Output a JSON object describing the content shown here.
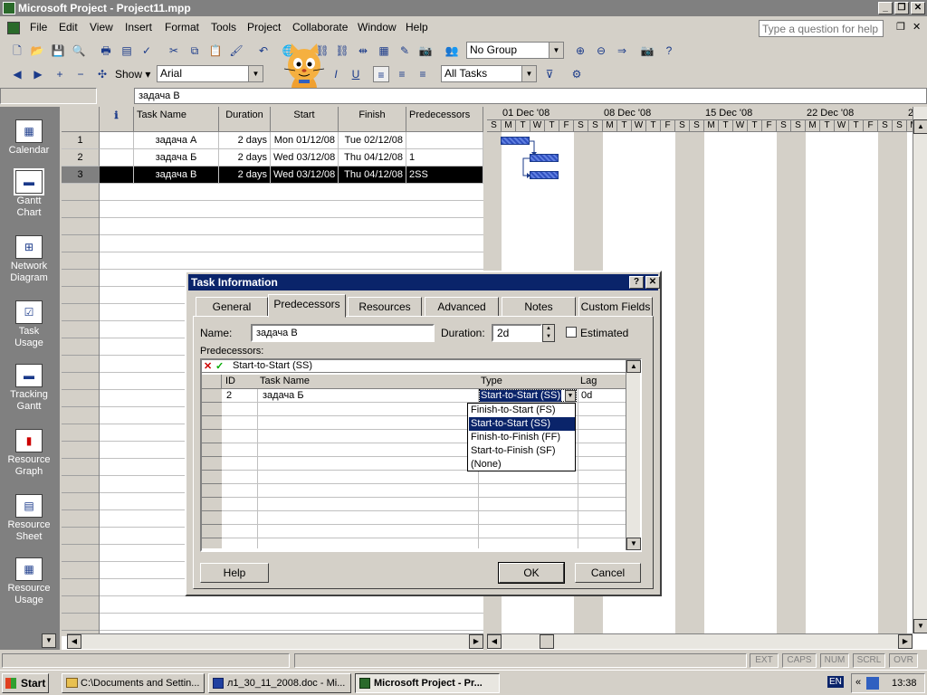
{
  "window": {
    "title": "Microsoft Project - Project11.mpp"
  },
  "menu": [
    "File",
    "Edit",
    "View",
    "Insert",
    "Format",
    "Tools",
    "Project",
    "Collaborate",
    "Window",
    "Help"
  ],
  "help_box": {
    "placeholder": "Type a question for help"
  },
  "toolbar1": {
    "group_value": "No Group"
  },
  "toolbar2": {
    "show_label": "Show",
    "font_value": "Arial",
    "filter_value": "All Tasks"
  },
  "entry_bar": {
    "value": "задача В"
  },
  "view_bar": [
    {
      "label": "Calendar",
      "icon": "calendar-icon"
    },
    {
      "label": "Gantt Chart",
      "icon": "gantt-chart-icon"
    },
    {
      "label": "Network Diagram",
      "icon": "network-diagram-icon"
    },
    {
      "label": "Task Usage",
      "icon": "task-usage-icon"
    },
    {
      "label": "Tracking Gantt",
      "icon": "tracking-gantt-icon"
    },
    {
      "label": "Resource Graph",
      "icon": "resource-graph-icon"
    },
    {
      "label": "Resource Sheet",
      "icon": "resource-sheet-icon"
    },
    {
      "label": "Resource Usage",
      "icon": "resource-usage-icon"
    }
  ],
  "table": {
    "headers": [
      "Task Name",
      "Duration",
      "Start",
      "Finish",
      "Predecessors"
    ],
    "rows": [
      {
        "id": "1",
        "name": "задача А",
        "duration": "2 days",
        "start": "Mon 01/12/08",
        "finish": "Tue 02/12/08",
        "pred": ""
      },
      {
        "id": "2",
        "name": "задача Б",
        "duration": "2 days",
        "start": "Wed 03/12/08",
        "finish": "Thu 04/12/08",
        "pred": "1"
      },
      {
        "id": "3",
        "name": "задача В",
        "duration": "2 days",
        "start": "Wed 03/12/08",
        "finish": "Thu 04/12/08",
        "pred": "2SS"
      }
    ]
  },
  "gantt": {
    "weeks": [
      "01 Dec '08",
      "08 Dec '08",
      "15 Dec '08",
      "22 Dec '08",
      "2"
    ],
    "days": [
      "S",
      "M",
      "T",
      "W",
      "T",
      "F",
      "S"
    ]
  },
  "dialog": {
    "title": "Task Information",
    "tabs": [
      "General",
      "Predecessors",
      "Resources",
      "Advanced",
      "Notes",
      "Custom Fields"
    ],
    "name_label": "Name:",
    "name_value": "задача В",
    "duration_label": "Duration:",
    "duration_value": "2d",
    "estimated_label": "Estimated",
    "predecessors_label": "Predecessors:",
    "edit_value": "Start-to-Start (SS)",
    "grid_headers": [
      "ID",
      "Task Name",
      "Type",
      "Lag"
    ],
    "grid_row": {
      "id": "2",
      "name": "задача Б",
      "type": "Start-to-Start (SS)",
      "lag": "0d"
    },
    "type_options": [
      "Finish-to-Start (FS)",
      "Start-to-Start (SS)",
      "Finish-to-Finish (FF)",
      "Start-to-Finish (SF)",
      "(None)"
    ],
    "help_button": "Help",
    "ok_button": "OK",
    "cancel_button": "Cancel"
  },
  "status": [
    "EXT",
    "CAPS",
    "NUM",
    "SCRL",
    "OVR"
  ],
  "taskbar": {
    "start": "Start",
    "tasks": [
      "C:\\Documents and Settin...",
      "л1_30_11_2008.doc - Mi...",
      "Microsoft Project - Pr..."
    ],
    "lang": "EN",
    "clock": "13:38"
  }
}
